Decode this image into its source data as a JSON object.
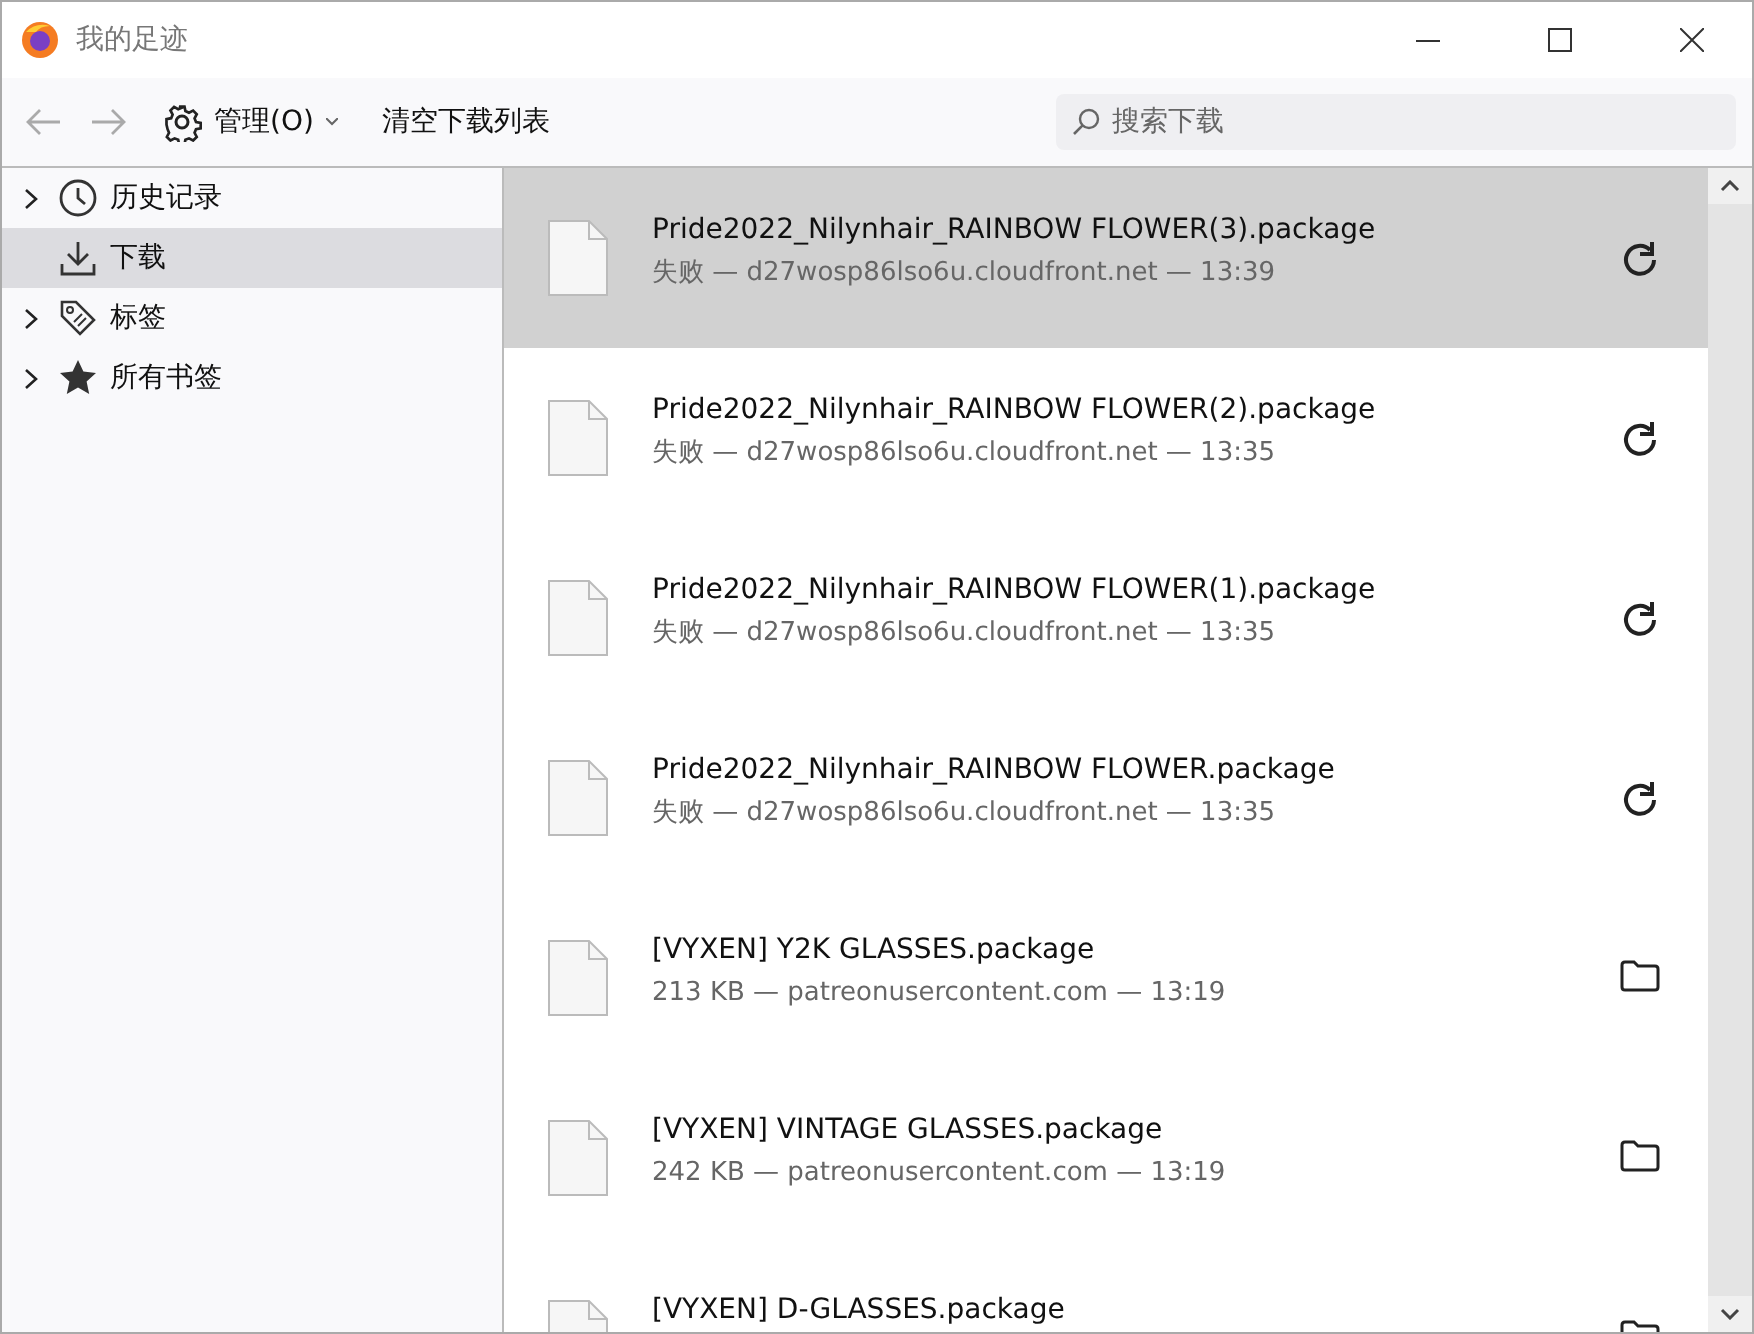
{
  "window": {
    "title": "我的足迹"
  },
  "toolbar": {
    "manage": "管理(O)",
    "clear": "清空下载列表"
  },
  "search": {
    "placeholder": "搜索下载"
  },
  "sidebar": {
    "items": [
      {
        "label": "历史记录",
        "kind": "history",
        "expandable": true,
        "selected": false
      },
      {
        "label": "下载",
        "kind": "downloads",
        "expandable": false,
        "selected": true
      },
      {
        "label": "标签",
        "kind": "tags",
        "expandable": true,
        "selected": false
      },
      {
        "label": "所有书签",
        "kind": "bookmarks",
        "expandable": true,
        "selected": false
      }
    ]
  },
  "downloads": [
    {
      "name": "Pride2022_Nilynhair_RAINBOW FLOWER(3).package",
      "detail": "失败 — d27wosp86lso6u.cloudfront.net — 13:39",
      "kind": "failed",
      "selected": true
    },
    {
      "name": "Pride2022_Nilynhair_RAINBOW FLOWER(2).package",
      "detail": "失败 — d27wosp86lso6u.cloudfront.net — 13:35",
      "kind": "failed",
      "selected": false
    },
    {
      "name": "Pride2022_Nilynhair_RAINBOW FLOWER(1).package",
      "detail": "失败 — d27wosp86lso6u.cloudfront.net — 13:35",
      "kind": "failed",
      "selected": false
    },
    {
      "name": "Pride2022_Nilynhair_RAINBOW FLOWER.package",
      "detail": "失败 — d27wosp86lso6u.cloudfront.net — 13:35",
      "kind": "failed",
      "selected": false
    },
    {
      "name": "[VYXEN] Y2K GLASSES.package",
      "detail": "213 KB — patreonusercontent.com — 13:19",
      "kind": "done",
      "selected": false
    },
    {
      "name": "[VYXEN] VINTAGE GLASSES.package",
      "detail": "242 KB — patreonusercontent.com — 13:19",
      "kind": "done",
      "selected": false
    },
    {
      "name": "[VYXEN] D-GLASSES.package",
      "kind": "done",
      "selected": false
    }
  ]
}
